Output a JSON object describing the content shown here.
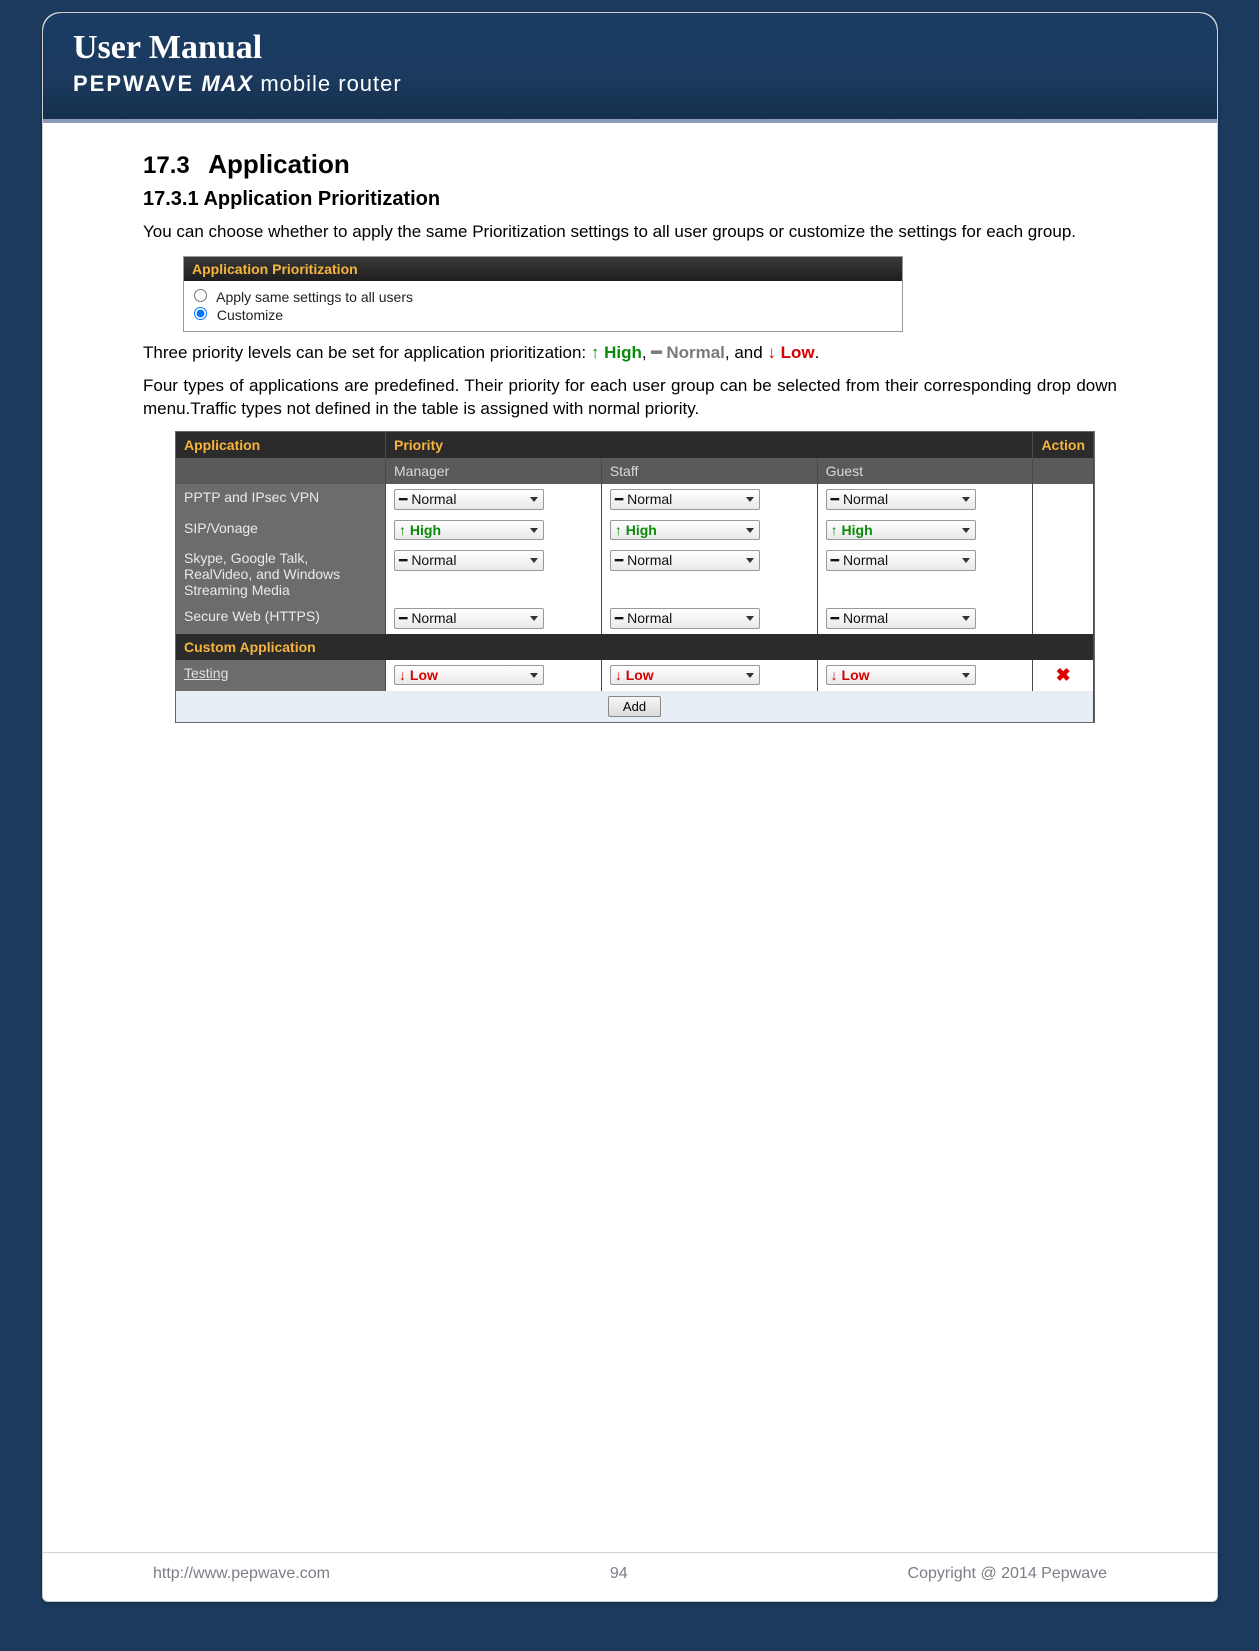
{
  "header": {
    "title": "User Manual",
    "brand": "PEPWAVE",
    "model": "MAX",
    "tag": "mobile router"
  },
  "section": {
    "num": "17.3",
    "title": "Application",
    "sub_num": "17.3.1",
    "sub_title": "Application Prioritization"
  },
  "para1": "You can choose whether to apply the same Prioritization settings to all user groups or customize the settings for each group.",
  "apbox": {
    "caption": "Application Prioritization",
    "opt_all": "Apply same settings to all users",
    "opt_custom": "Customize",
    "selected": "customize"
  },
  "para2_pre": "Three priority levels can be set for application prioritization: ",
  "priorities": {
    "high": "↑ High",
    "normal": "━ Normal",
    "low": "↓ Low"
  },
  "para3": "Four types of applications are predefined. Their priority for each user group can be selected from their corresponding drop down menu.Traffic types not defined in the table is assigned with normal priority.",
  "table": {
    "cols": {
      "app": "Application",
      "priority": "Priority",
      "action": "Action"
    },
    "groups": [
      "Manager",
      "Staff",
      "Guest"
    ],
    "opt_normal": "━ Normal",
    "opt_high": "↑ High",
    "opt_low": "↓ Low",
    "rows": [
      {
        "app": "PPTP and IPsec VPN",
        "vals": [
          "normal",
          "normal",
          "normal"
        ]
      },
      {
        "app": "SIP/Vonage",
        "vals": [
          "high",
          "high",
          "high"
        ]
      },
      {
        "app": "Skype, Google Talk, RealVideo, and Windows Streaming Media",
        "vals": [
          "normal",
          "normal",
          "normal"
        ]
      },
      {
        "app": "Secure Web (HTTPS)",
        "vals": [
          "normal",
          "normal",
          "normal"
        ]
      }
    ],
    "custom_header": "Custom Application",
    "custom_rows": [
      {
        "app": "Testing",
        "vals": [
          "low",
          "low",
          "low"
        ]
      }
    ],
    "add_label": "Add"
  },
  "footer": {
    "url": "http://www.pepwave.com",
    "page": "94",
    "copyright": "Copyright @ 2014 Pepwave"
  }
}
